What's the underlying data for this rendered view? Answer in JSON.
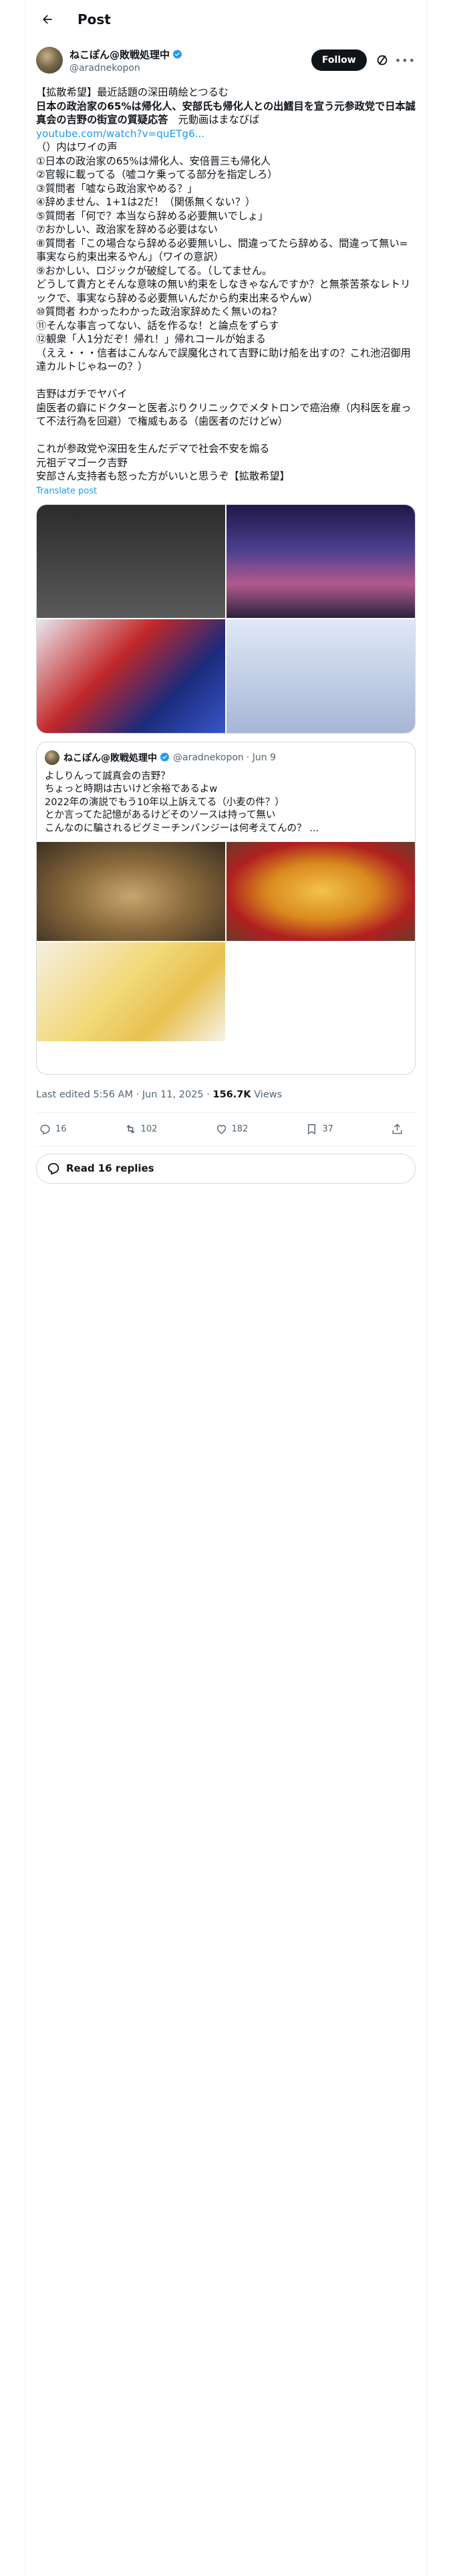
{
  "header": {
    "title": "Post"
  },
  "author": {
    "name": "ねこぽん@敗戦処理中",
    "handle": "@aradnekopon",
    "follow_label": "Follow"
  },
  "post": {
    "line1": "【拡散希望】最近話題の深田萌絵とつるむ",
    "line2_bold": "日本の政治家の65%は帰化人、安部氏も帰化人との出鱈目を宣う元参政党で日本誠真会の吉野の街宣の質疑応答",
    "line2_tail": "　元動画はまなびば",
    "link": "youtube.com/watch?v=quETg6...",
    "rest": "（）内はワイの声\n①日本の政治家の65%は帰化人、安倍晋三も帰化人\n②官報に載ってる（嘘コケ乗ってる部分を指定しろ）\n③質問者「嘘なら政治家やめる？」\n④辞めません、1+1は2だ！（関係無くない？）\n⑤質問者「何で？本当なら辞める必要無いでしょ」\n⑦おかしい、政治家を辞める必要はない\n⑧質問者「この場合なら辞める必要無いし、間違ってたら辞める、間違って無い=事実なら約束出来るやん」（ワイの意訳）\n⑨おかしい、ロジックが破綻してる。（してません。\nどうして貴方とそんな意味の無い約束をしなきゃなんですか？と無茶苦茶なレトリックで、事実なら辞める必要無いんだから約束出来るやんw）\n⑩質問者 わかったわかった政治家辞めたく無いのね？\n⑪そんな事言ってない、話を作るな！と論点をずらす\n⑫観衆「人1分だぞ！帰れ！」帰れコールが始まる\n（ええ・・・信者はこんなんで誤魔化されて吉野に助け船を出すの？これ池沼御用達カルトじゃねーの？）\n\n吉野はガチでヤバイ\n歯医者の癖にドクターと医者ぶりクリニックでメタトロンで癌治療（内科医を雇って不法行為を回避）で権威もある（歯医者のだけどw）\n\nこれが参政党や深田を生んだデマで社会不安を煽る\n元祖デマゴーク吉野\n安部さん支持者も怒った方がいいと思うぞ【拡散希望】",
    "translate_label": "Translate post",
    "media": [
      {
        "label": "street-speech-qa-thumbnail"
      },
      {
        "label": "event-photo-thumbnail"
      },
      {
        "label": "news-panel-thumbnail"
      },
      {
        "label": "versus-poster-thumbnail"
      }
    ]
  },
  "quote": {
    "name": "ねこぽん@敗戦処理中",
    "handle": "@aradnekopon",
    "date": "· Jun 9",
    "text": "よしりんって誠真会の吉野？\nちょっと時期は古いけど余裕であるよw\n2022年の演説でもう10年以上訴えてる（小麦の件？）\nとか言ってた記憶があるけどそのソースは持って無い\nこんなのに騙されるビグミーチンパンジーは何考えてんの？ ..."
  },
  "meta": {
    "edited": "Last edited 5:56 AM · Jun 11, 2025 · ",
    "views_count": "156.7K",
    "views_label": " Views"
  },
  "actions": {
    "replies": "16",
    "reposts": "102",
    "likes": "182",
    "bookmarks": "37"
  },
  "read_replies_label": "Read 16 replies",
  "colors": {
    "accent": "#1d9bf0",
    "text": "#0f1419",
    "muted": "#536471"
  }
}
